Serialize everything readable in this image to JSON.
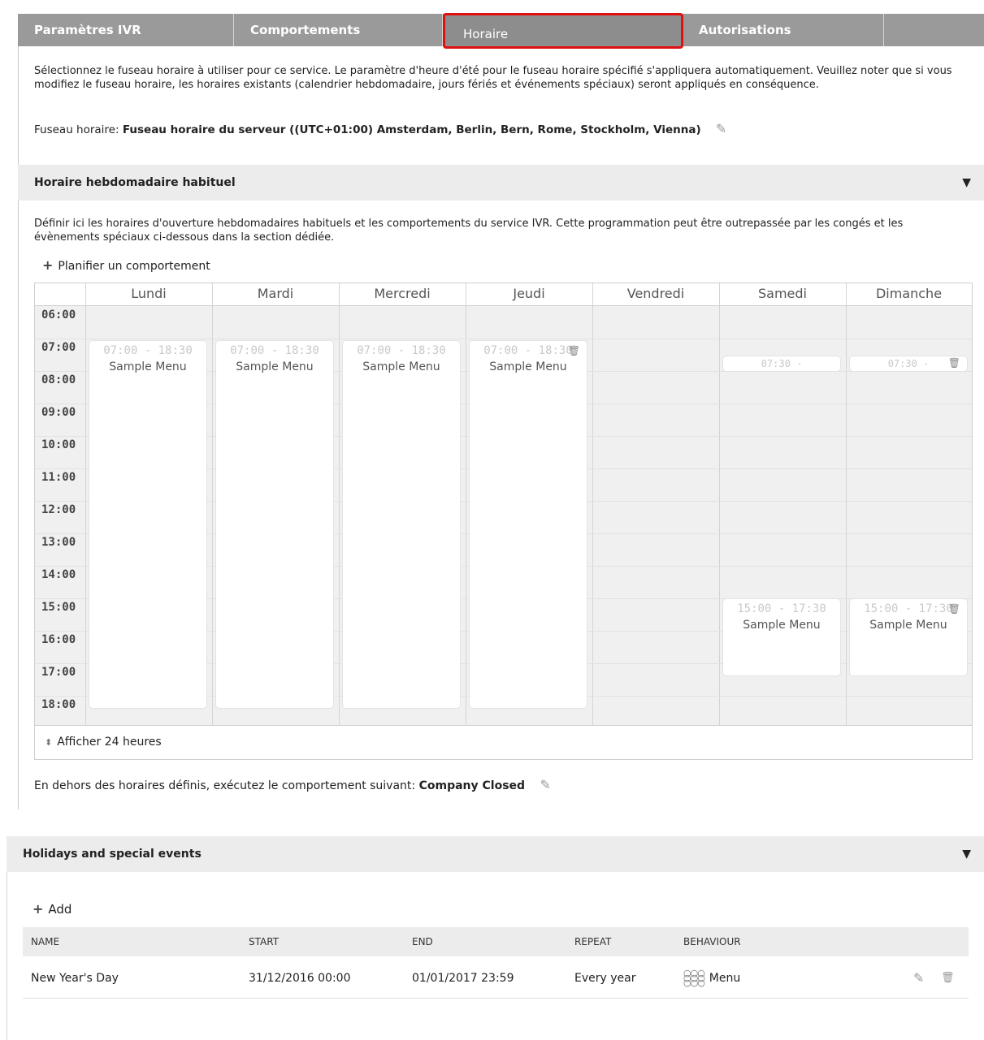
{
  "tabs": [
    "Paramètres IVR",
    "Comportements",
    "Horaire",
    "Autorisations"
  ],
  "active_tab": "Horaire",
  "intro_text": "Sélectionnez le fuseau horaire à utiliser pour ce service. Le paramètre d'heure d'été pour le fuseau horaire spécifié s'appliquera automatiquement. Veuillez noter que si vous modifiez le fuseau horaire, les horaires existants (calendrier hebdomadaire, jours fériés et événements spéciaux) seront appliqués en conséquence.",
  "timezone": {
    "label": "Fuseau horaire:",
    "value": "Fuseau horaire du serveur ((UTC+01:00) Amsterdam, Berlin, Bern, Rome, Stockholm, Vienna)"
  },
  "weekly": {
    "title": "Horaire hebdomadaire habituel",
    "description": "Définir ici les horaires d'ouverture hebdomadaires habituels et les comportements du service IVR. Cette programmation peut être outrepassée par les congés et les évènements spéciaux ci-dessous dans la section dédiée.",
    "add_label": "Planifier un comportement",
    "days": [
      "Lundi",
      "Mardi",
      "Mercredi",
      "Jeudi",
      "Vendredi",
      "Samedi",
      "Dimanche"
    ],
    "hours": [
      "06:00",
      "07:00",
      "08:00",
      "09:00",
      "10:00",
      "11:00",
      "12:00",
      "13:00",
      "14:00",
      "15:00",
      "16:00",
      "17:00",
      "18:00"
    ],
    "events": [
      {
        "day": "Lundi",
        "time": "07:00 - 18:30",
        "name": "Sample Menu"
      },
      {
        "day": "Mardi",
        "time": "07:00 - 18:30",
        "name": "Sample Menu"
      },
      {
        "day": "Mercredi",
        "time": "07:00 - 18:30",
        "name": "Sample Menu"
      },
      {
        "day": "Jeudi",
        "time": "07:00 - 18:30",
        "name": "Sample Menu"
      },
      {
        "day": "Samedi",
        "time": "07:30 -",
        "name": ""
      },
      {
        "day": "Dimanche",
        "time": "07:30 -",
        "name": ""
      },
      {
        "day": "Samedi",
        "time": "15:00 - 17:30",
        "name": "Sample Menu"
      },
      {
        "day": "Dimanche",
        "time": "15:00 - 17:30",
        "name": "Sample Menu"
      }
    ],
    "show_24_label": "Afficher 24 heures",
    "outside_label": "En dehors des horaires définis, exécutez le comportement suivant:",
    "outside_value": "Company Closed"
  },
  "holidays": {
    "title": "Holidays and special events",
    "add_label": "Add",
    "columns": [
      "NAME",
      "START",
      "END",
      "REPEAT",
      "BEHAVIOUR"
    ],
    "rows": [
      {
        "name": "New Year's Day",
        "start": "31/12/2016 00:00",
        "end": "01/01/2017 23:59",
        "repeat": "Every year",
        "behaviour": "Menu"
      }
    ]
  }
}
